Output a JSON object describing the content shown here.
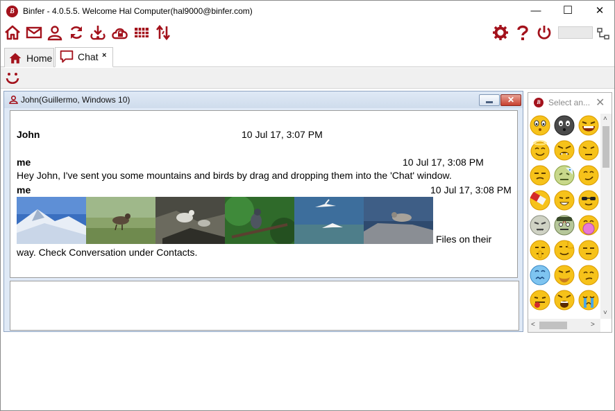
{
  "window": {
    "title": "Binfer - 4.0.5.5. Welcome Hal Computer(hal9000@binfer.com)",
    "logo_letter": "B",
    "controls": {
      "minimize": "—",
      "maximize": "☐",
      "close": "✕"
    }
  },
  "toolbar": {
    "icons": [
      "home-icon",
      "mail-icon",
      "user-icon",
      "sync-icon",
      "download-cloud-icon",
      "lock-cloud-icon",
      "grid-icon",
      "transfer-icon"
    ],
    "right_icons": [
      "gear-icon",
      "help-icon",
      "power-icon",
      "network-icon"
    ],
    "accent": "#a3121c"
  },
  "tabs": [
    {
      "label": "Home",
      "icon": "home-icon"
    },
    {
      "label": "Chat",
      "icon": "chat-bubble-icon",
      "close": "×"
    }
  ],
  "chat": {
    "header": "John(Guillermo, Windows 10)",
    "close_label": "✕",
    "messages": [
      {
        "sender": "John",
        "time": "10 Jul 17, 3:07 PM"
      },
      {
        "sender": "me",
        "time": "10 Jul 17, 3:08 PM",
        "text": "Hey John, I've sent you some mountains and birds by drag and dropping them into the 'Chat' window."
      },
      {
        "sender": "me",
        "time": "10 Jul 17, 3:08 PM",
        "text_after_images": "Files on their",
        "text_line2": "way. Check Conversation under Contacts."
      }
    ],
    "images": [
      "snowy-mountain",
      "bird-on-grass",
      "birds-on-rocks",
      "bird-on-branch",
      "flying-terns",
      "dove-on-rock"
    ]
  },
  "emoji_panel": {
    "logo_letter": "B",
    "search_placeholder": "Select an...",
    "close": "✕",
    "scroll_up": "˄",
    "scroll_down": "˅",
    "scroll_left": "<",
    "scroll_right": ">"
  }
}
